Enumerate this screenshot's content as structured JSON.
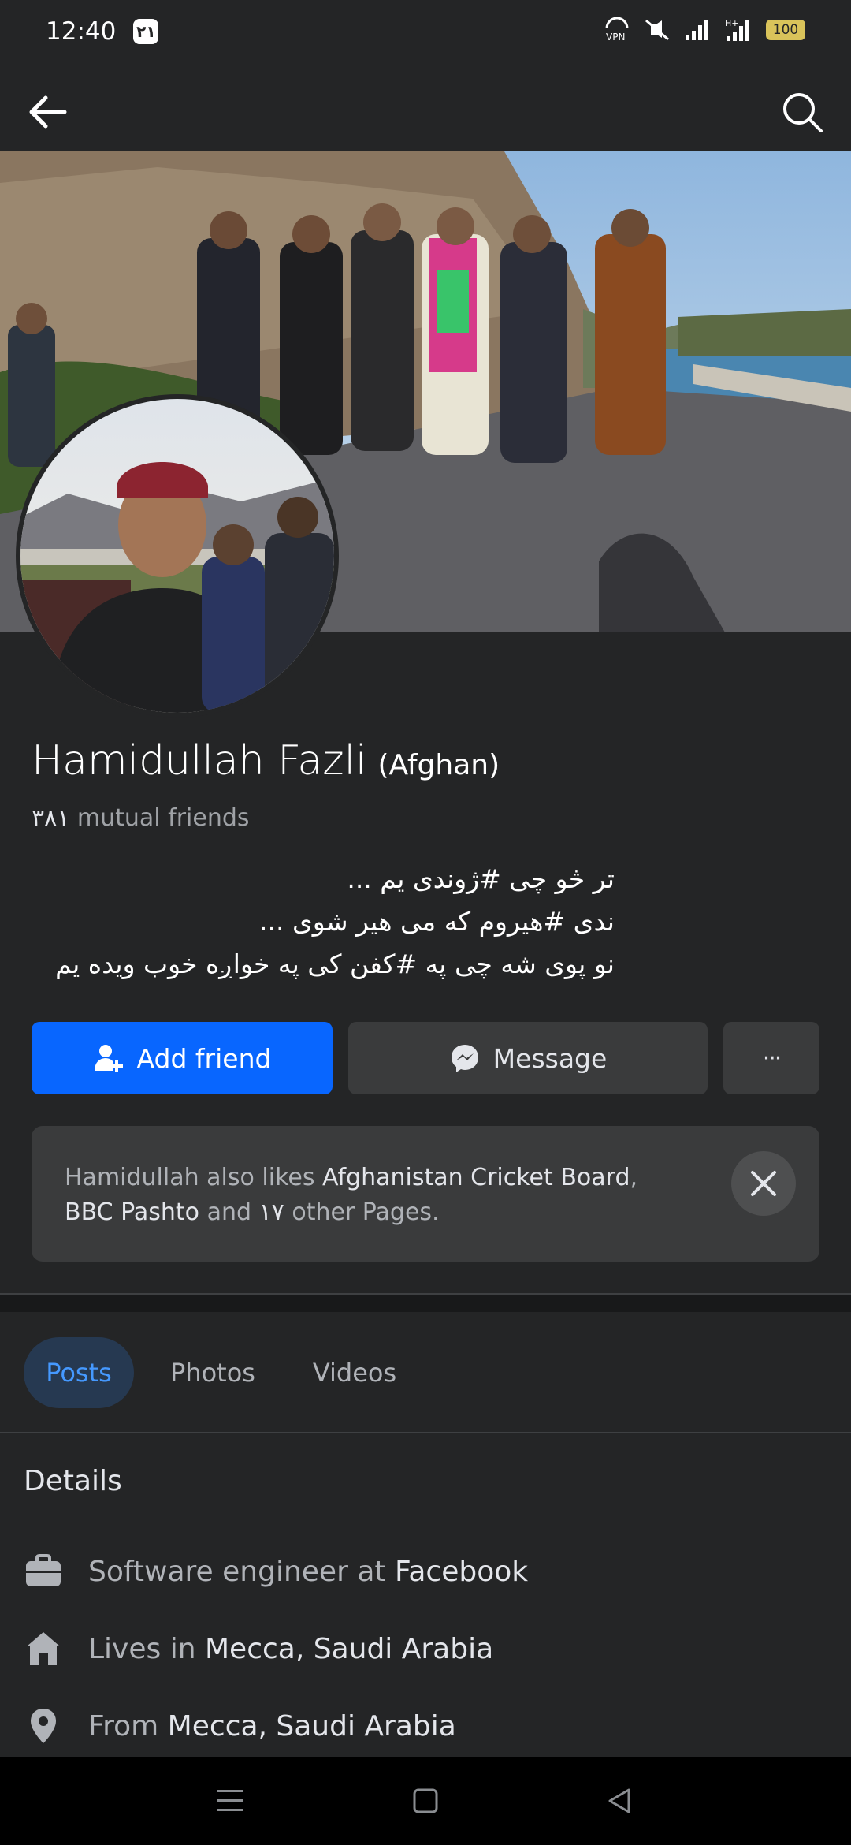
{
  "status": {
    "time": "12:40",
    "notification_badge": "۲۱",
    "battery": "100",
    "vpn": "VPN"
  },
  "profile": {
    "name": "Hamidullah Fazli",
    "alt_name": "(Afghan)",
    "mutual_count": "۳۸۱",
    "mutual_label": "mutual friends",
    "bio": [
      "تر څو چی #ژوندی یم ...",
      "ندی #هیروم که می هیر شوی ...",
      "نو پوی شه چی په #کفن کی په خواږه خوب ویده یم"
    ]
  },
  "actions": {
    "add_friend": "Add friend",
    "message": "Message",
    "more": "···"
  },
  "likes": {
    "prefix": "Hamidullah also likes",
    "page1": "Afghanistan Cricket Board",
    "sep": ",",
    "page2": "BBC Pashto",
    "and": "and",
    "count": "۱۷",
    "suffix": "other Pages."
  },
  "tabs": [
    "Posts",
    "Photos",
    "Videos"
  ],
  "details": {
    "title": "Details",
    "work_prefix": "Software engineer at",
    "work_place": "Facebook",
    "lives_prefix": "Lives in",
    "lives_place": "Mecca, Saudi Arabia",
    "from_prefix": "From",
    "from_place": "Mecca, Saudi Arabia"
  },
  "colors": {
    "accent": "#0866ff",
    "background": "#242526",
    "card": "#3a3b3c",
    "active_tab": "#263951"
  }
}
